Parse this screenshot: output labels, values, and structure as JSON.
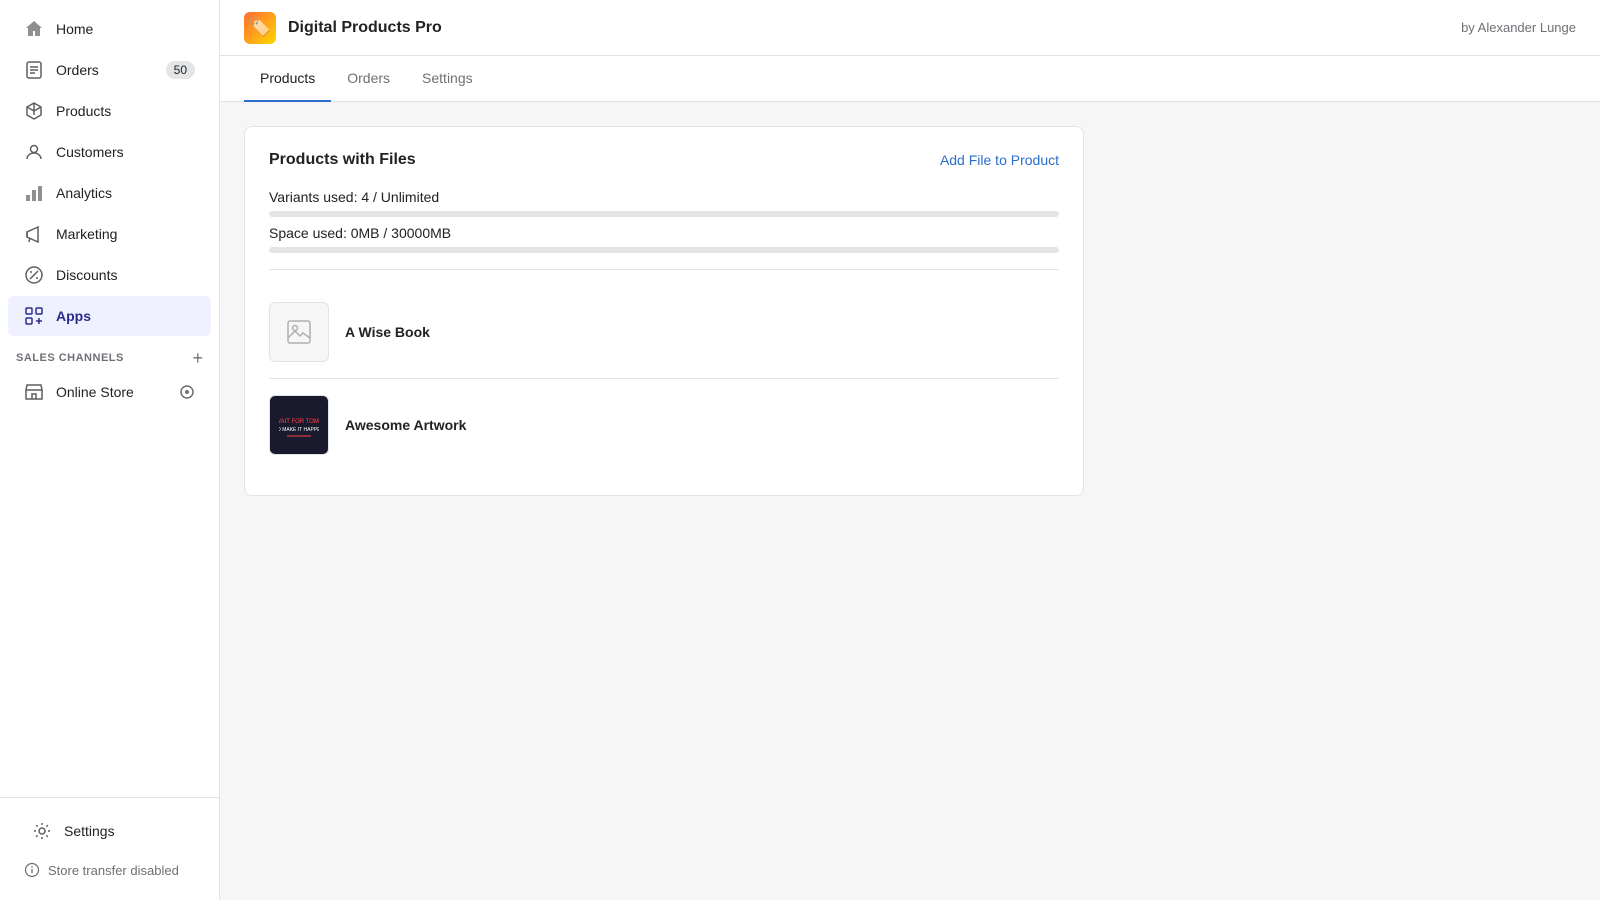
{
  "sidebar": {
    "items": [
      {
        "id": "home",
        "label": "Home",
        "icon": "home",
        "badge": null,
        "active": false
      },
      {
        "id": "orders",
        "label": "Orders",
        "icon": "orders",
        "badge": "50",
        "active": false
      },
      {
        "id": "products",
        "label": "Products",
        "icon": "products",
        "badge": null,
        "active": false
      },
      {
        "id": "customers",
        "label": "Customers",
        "icon": "customers",
        "badge": null,
        "active": false
      },
      {
        "id": "analytics",
        "label": "Analytics",
        "icon": "analytics",
        "badge": null,
        "active": false
      },
      {
        "id": "marketing",
        "label": "Marketing",
        "icon": "marketing",
        "badge": null,
        "active": false
      },
      {
        "id": "discounts",
        "label": "Discounts",
        "icon": "discounts",
        "badge": null,
        "active": false
      },
      {
        "id": "apps",
        "label": "Apps",
        "icon": "apps",
        "badge": null,
        "active": true
      }
    ],
    "sales_channels_title": "SALES CHANNELS",
    "sales_channels": [
      {
        "id": "online-store",
        "label": "Online Store",
        "icon": "store"
      }
    ],
    "bottom_items": [
      {
        "id": "settings",
        "label": "Settings",
        "icon": "settings"
      }
    ],
    "store_transfer_label": "Store transfer disabled"
  },
  "app": {
    "title": "Digital Products Pro",
    "author": "by Alexander Lunge",
    "icon_emoji": "🏷️"
  },
  "tabs": [
    {
      "id": "products",
      "label": "Products",
      "active": true
    },
    {
      "id": "orders",
      "label": "Orders",
      "active": false
    },
    {
      "id": "settings",
      "label": "Settings",
      "active": false
    }
  ],
  "card": {
    "title": "Products with Files",
    "add_file_label": "Add File to Product",
    "variants_used_label": "Variants used: 4 / Unlimited",
    "space_used_label": "Space used: 0MB / 30000MB",
    "variants_progress": 0,
    "space_progress": 0,
    "products": [
      {
        "id": "wise-book",
        "name": "A Wise Book",
        "has_image": false
      },
      {
        "id": "awesome-artwork",
        "name": "Awesome Artwork",
        "has_image": true
      }
    ]
  }
}
